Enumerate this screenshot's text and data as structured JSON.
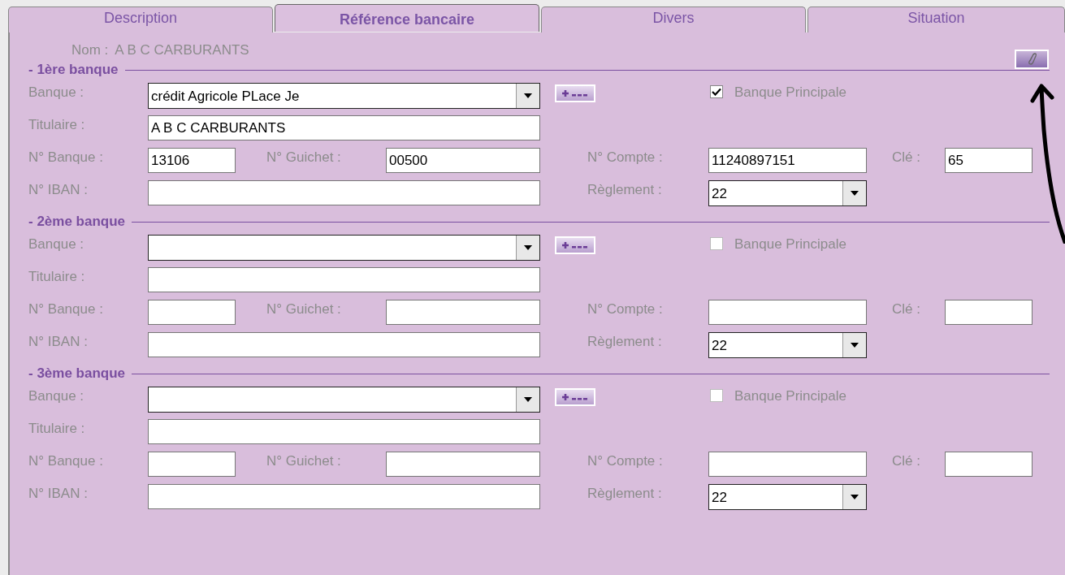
{
  "tabs": [
    {
      "label": "Description",
      "selected": false
    },
    {
      "label": "Référence bancaire",
      "selected": true
    },
    {
      "label": "Divers",
      "selected": false
    },
    {
      "label": "Situation",
      "selected": false
    }
  ],
  "nom": {
    "label": "Nom :",
    "value": "A B C CARBURANTS"
  },
  "banks": [
    {
      "heading": "- 1ère banque",
      "banque": {
        "label": "Banque :",
        "value": "crédit Agricole PLace Je"
      },
      "principale": {
        "label": "Banque Principale",
        "checked": true
      },
      "titulaire": {
        "label": "Titulaire :",
        "value": "A B C CARBURANTS"
      },
      "no_banque": {
        "label": "N° Banque :",
        "value": "13106"
      },
      "no_guichet": {
        "label": "N° Guichet :",
        "value": "00500"
      },
      "no_compte": {
        "label": "N° Compte :",
        "value": "11240897151"
      },
      "cle": {
        "label": "Clé :",
        "value": "65"
      },
      "iban": {
        "label": "N° IBAN :"
      },
      "reglement": {
        "label": "Règlement :",
        "value": "22"
      }
    },
    {
      "heading": "- 2ème banque",
      "banque": {
        "label": "Banque :"
      },
      "principale": {
        "label": "Banque Principale",
        "checked": false
      },
      "titulaire": {
        "label": "Titulaire :"
      },
      "no_banque": {
        "label": "N° Banque :"
      },
      "no_guichet": {
        "label": "N° Guichet :"
      },
      "no_compte": {
        "label": "N° Compte :"
      },
      "cle": {
        "label": "Clé :"
      },
      "iban": {
        "label": "N° IBAN :"
      },
      "reglement": {
        "label": "Règlement :",
        "value": "22"
      }
    },
    {
      "heading": "- 3ème banque",
      "banque": {
        "label": "Banque :"
      },
      "principale": {
        "label": "Banque Principale",
        "checked": false
      },
      "titulaire": {
        "label": "Titulaire :"
      },
      "no_banque": {
        "label": "N° Banque :"
      },
      "no_guichet": {
        "label": "N° Guichet :"
      },
      "no_compte": {
        "label": "N° Compte :"
      },
      "cle": {
        "label": "Clé :"
      },
      "iban": {
        "label": "N° IBAN :"
      },
      "reglement": {
        "label": "Règlement :",
        "value": "22"
      }
    }
  ]
}
